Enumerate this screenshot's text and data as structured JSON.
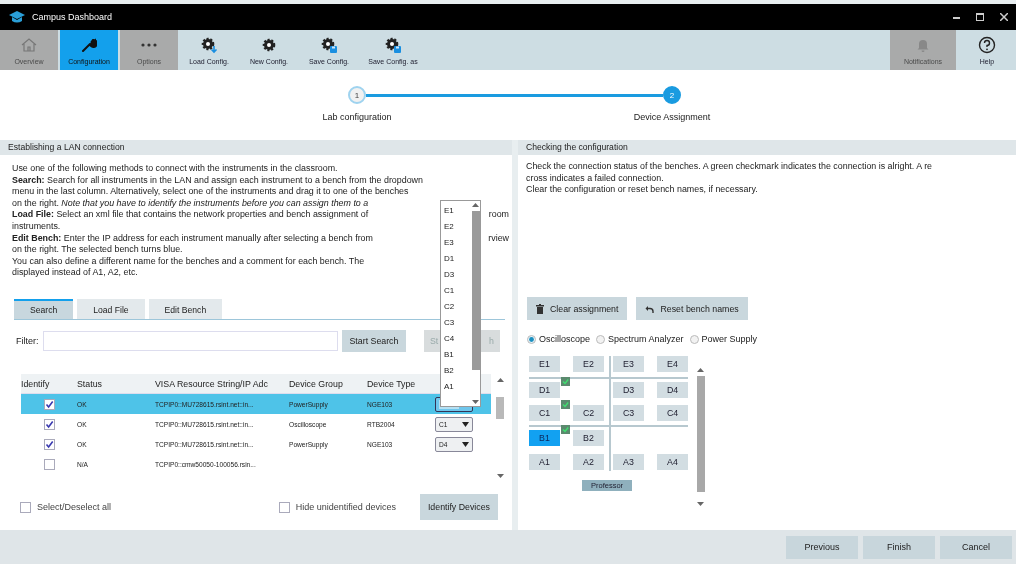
{
  "window": {
    "title": "Campus Dashboard"
  },
  "toolbar": {
    "left": [
      {
        "label": "Overview",
        "selected": false,
        "disabled": true
      },
      {
        "label": "Configuration",
        "selected": true,
        "disabled": false
      },
      {
        "label": "Options",
        "selected": false,
        "disabled": true
      },
      {
        "label": "Load Config.",
        "selected": false,
        "disabled": false
      },
      {
        "label": "New Config.",
        "selected": false,
        "disabled": false
      },
      {
        "label": "Save Config.",
        "selected": false,
        "disabled": false
      },
      {
        "label": "Save Config. as",
        "selected": false,
        "disabled": false
      }
    ],
    "right": [
      {
        "label": "Notifications",
        "selected": false,
        "disabled": true
      },
      {
        "label": "Help",
        "selected": false,
        "disabled": false
      }
    ]
  },
  "steps": [
    {
      "number": "1",
      "label": "Lab configuration",
      "active": false
    },
    {
      "number": "2",
      "label": "Device Assignment",
      "active": true
    }
  ],
  "lan_panel": {
    "title": "Establishing a LAN connection",
    "description": [
      {
        "text": "Use one of the following methods to connect with the instruments in the classroom."
      },
      {
        "text": "**Search:** Search for all instruments in the LAN and assign each instrument to a bench from the dropdown"
      },
      {
        "text": "menu in the last column. Alternatively, select one of the instruments and drag it to one of the benches"
      },
      {
        "text": "on the right. *Note that you have to identify the instruments before you can assign them to a*"
      },
      {
        "text": "**Load File:** Select an xml file that contains the network properties and bench assignment of",
        "tail": "room"
      },
      {
        "text": "instruments."
      },
      {
        "text": "**Edit Bench:** Enter the IP address for each instrument manually after selecting a bench from",
        "tail": "rview"
      },
      {
        "text": "on the right. The selected bench turns blue."
      },
      {
        "text": "You can also define a different name for the benches and a comment for each bench. The"
      },
      {
        "text": "displayed instead of A1, A2, etc."
      }
    ],
    "tabs": [
      {
        "label": "Search",
        "selected": true
      },
      {
        "label": "Load File",
        "selected": false
      },
      {
        "label": "Edit Bench",
        "selected": false
      }
    ],
    "filter": {
      "label": "Filter:"
    },
    "start_search": "Start Search",
    "stop_search": {
      "head": "St",
      "tail": "h",
      "disabled": true
    },
    "table": {
      "columns": [
        "Identify",
        "Status",
        "VISA Resource String/IP Adc",
        "Device Group",
        "Device Type"
      ],
      "rows": [
        {
          "identify": true,
          "status": "OK",
          "resource": "TCPIP0::MU728615.rsint.net::in...",
          "group": "PowerSupply",
          "type": "NGE103",
          "selected": true,
          "bench_select": {
            "open": true
          }
        },
        {
          "identify": true,
          "status": "OK",
          "resource": "TCPIP0::MU728615.rsint.net::in...",
          "group": "Oscilloscope",
          "type": "RTB2004",
          "selected": false,
          "bench_select": {
            "open": false,
            "value": "C1"
          }
        },
        {
          "identify": true,
          "status": "OK",
          "resource": "TCPIP0::MU728615.rsint.net::in...",
          "group": "PowerSupply",
          "type": "NGE103",
          "selected": false,
          "bench_select": {
            "open": false,
            "value": "D4"
          }
        },
        {
          "identify": false,
          "status": "N/A",
          "resource": "TCPIP0::cmw50050-100056.rsin...",
          "selected": false
        }
      ]
    },
    "bench_list": [
      "E1",
      "E2",
      "E3",
      "D1",
      "D3",
      "C1",
      "C2",
      "C3",
      "C4",
      "B1",
      "B2",
      "A1"
    ],
    "select_all": {
      "label": "Select/Deselect all",
      "checked": false
    },
    "hide_unidentified": {
      "label": "Hide unidentified devices",
      "checked": false
    },
    "identify_button": "Identify Devices"
  },
  "check_panel": {
    "title": "Checking the configuration",
    "description": [
      "Check the connection status of the benches. A green checkmark indicates the connection is alright. A re",
      "cross indicates a failed connection.",
      "Clear the configuration or reset bench names, if necessary."
    ],
    "clear_button": "Clear assignment",
    "reset_button": "Reset bench names",
    "device_types": [
      {
        "label": "Oscilloscope",
        "selected": true
      },
      {
        "label": "Spectrum Analyzer",
        "selected": false
      },
      {
        "label": "Power Supply",
        "selected": false
      }
    ],
    "bench_rows": [
      [
        {
          "label": "E1",
          "connected": false,
          "selected": false
        },
        {
          "label": "E2",
          "connected": false,
          "selected": false
        },
        {
          "label": "E3",
          "connected": false,
          "selected": false
        },
        {
          "label": "E4",
          "connected": false,
          "selected": false
        }
      ],
      [
        {
          "label": "D1",
          "connected": true,
          "selected": false
        },
        null,
        {
          "label": "D3",
          "connected": false,
          "selected": false
        },
        {
          "label": "D4",
          "connected": false,
          "selected": false
        }
      ],
      [
        {
          "label": "C1",
          "connected": true,
          "selected": false
        },
        {
          "label": "C2",
          "connected": false,
          "selected": false
        },
        {
          "label": "C3",
          "connected": false,
          "selected": false
        },
        {
          "label": "C4",
          "connected": false,
          "selected": false
        }
      ],
      [
        {
          "label": "B1",
          "connected": true,
          "selected": true
        },
        {
          "label": "B2",
          "connected": false,
          "selected": false
        },
        null,
        null
      ],
      [
        {
          "label": "A1",
          "connected": false,
          "selected": false
        },
        {
          "label": "A2",
          "connected": false,
          "selected": false
        },
        {
          "label": "A3",
          "connected": false,
          "selected": false
        },
        {
          "label": "A4",
          "connected": false,
          "selected": false
        }
      ]
    ],
    "professor": "Professor"
  },
  "footer": {
    "buttons": [
      "Previous",
      "Finish",
      "Cancel"
    ]
  }
}
